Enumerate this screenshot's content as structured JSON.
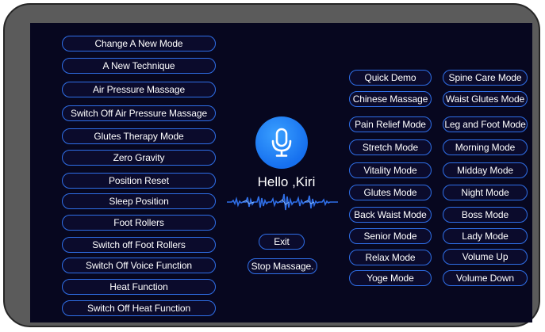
{
  "left_commands": [
    "Change A New Mode",
    "A New Technique",
    "Air Pressure Massage",
    "Switch Off Air Pressure Massage",
    "Glutes Therapy Mode",
    "Zero Gravity",
    "Position Reset",
    "Sleep Position",
    "Foot Rollers",
    "Switch off Foot Rollers",
    "Switch Off Voice Function",
    "Heat Function",
    "Switch Off Heat Function"
  ],
  "center": {
    "greeting": "Hello ,Kiri",
    "exit_label": "Exit",
    "stop_label": "Stop Massage."
  },
  "mid_commands": [
    "Quick Demo",
    "Chinese Massage",
    "Pain Relief Mode",
    "Stretch Mode",
    "Vitality Mode",
    "Glutes Mode",
    "Back Waist Mode",
    "Senior Mode",
    "Relax Mode",
    "Yoge Mode"
  ],
  "right_commands": [
    "Spine Care Mode",
    "Waist Glutes Mode",
    "Leg and Foot Mode",
    "Morning Mode",
    "Midday Mode",
    "Night Mode",
    "Boss Mode",
    "Lady Mode",
    "Volume Up",
    "Volume Down"
  ],
  "colors": {
    "accent": "#2f6fe8",
    "screen": "#07071f",
    "mic": "#1670ef"
  },
  "icons": {
    "microphone": "microphone-icon",
    "voice_wave": "voice-waveform-icon"
  }
}
